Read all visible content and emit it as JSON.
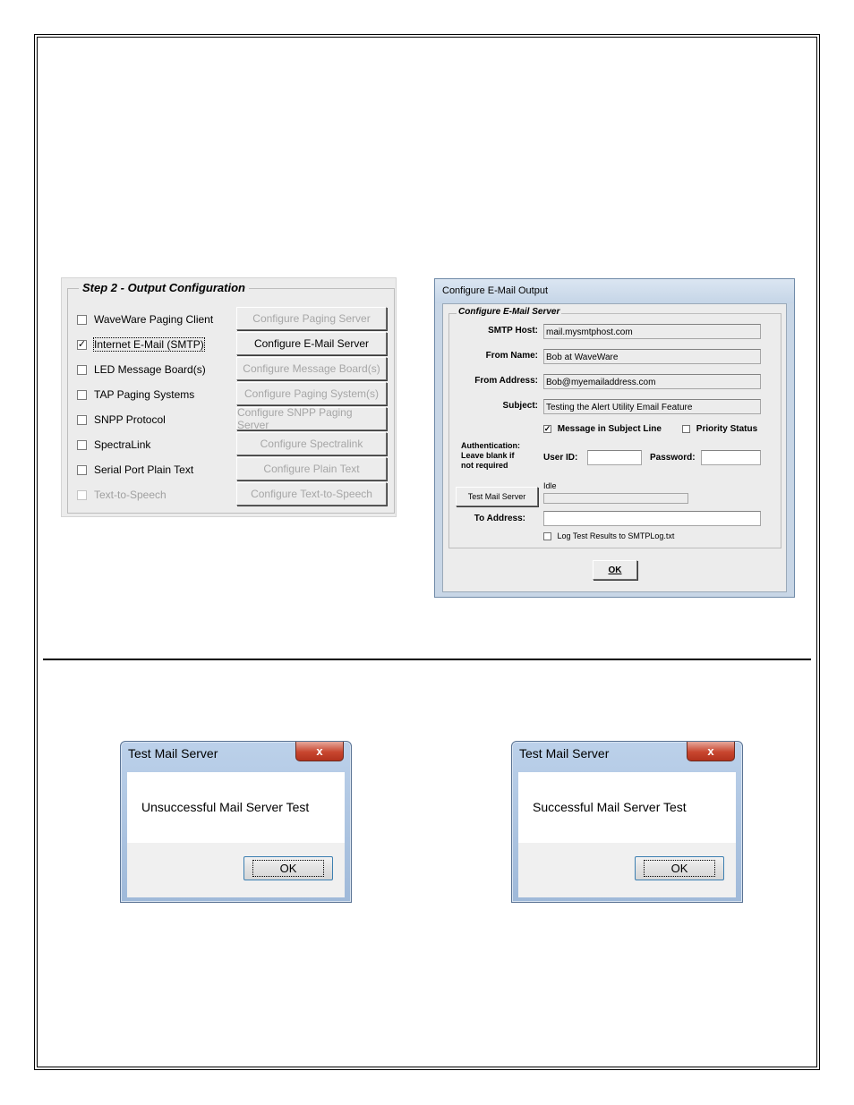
{
  "step2": {
    "title": "Step 2 - Output Configuration",
    "options": [
      {
        "label": "WaveWare Paging Client",
        "checked": false,
        "disabled": false,
        "button": "Configure Paging Server",
        "button_enabled": false
      },
      {
        "label": "Internet E-Mail (SMTP)",
        "checked": true,
        "disabled": false,
        "button": "Configure E-Mail Server",
        "button_enabled": true
      },
      {
        "label": "LED Message Board(s)",
        "checked": false,
        "disabled": false,
        "button": "Configure Message Board(s)",
        "button_enabled": false
      },
      {
        "label": "TAP Paging Systems",
        "checked": false,
        "disabled": false,
        "button": "Configure Paging System(s)",
        "button_enabled": false
      },
      {
        "label": "SNPP Protocol",
        "checked": false,
        "disabled": false,
        "button": "Configure SNPP Paging Server",
        "button_enabled": false
      },
      {
        "label": "SpectraLink",
        "checked": false,
        "disabled": false,
        "button": "Configure Spectralink",
        "button_enabled": false
      },
      {
        "label": "Serial Port Plain Text",
        "checked": false,
        "disabled": false,
        "button": "Configure Plain Text",
        "button_enabled": false
      },
      {
        "label": "Text-to-Speech",
        "checked": false,
        "disabled": true,
        "button": "Configure Text-to-Speech",
        "button_enabled": false
      }
    ]
  },
  "email_dialog": {
    "title": "Configure E-Mail Output",
    "group_title": "Configure E-Mail Server",
    "smtp_host_label": "SMTP Host:",
    "smtp_host_value": "mail.mysmtphost.com",
    "from_name_label": "From Name:",
    "from_name_value": "Bob at WaveWare",
    "from_address_label": "From Address:",
    "from_address_value": "Bob@myemailaddress.com",
    "subject_label": "Subject:",
    "subject_value": "Testing the Alert Utility Email Feature",
    "message_in_subject_label": "Message in Subject Line",
    "message_in_subject_checked": true,
    "priority_status_label": "Priority Status",
    "priority_status_checked": false,
    "auth_label_1": "Authentication:",
    "auth_label_2": "Leave blank if",
    "auth_label_3": "not required",
    "user_id_label": "User ID:",
    "user_id_value": "",
    "password_label": "Password:",
    "password_value": "",
    "test_button": "Test Mail Server",
    "status_text": "Idle",
    "to_address_label": "To Address:",
    "to_address_value": "",
    "log_label": "Log Test Results to SMTPLog.txt",
    "log_checked": false,
    "ok_button": "OK"
  },
  "msg_fail": {
    "title": "Test Mail Server",
    "close": "x",
    "message": "Unsuccessful Mail Server Test",
    "ok": "OK"
  },
  "msg_success": {
    "title": "Test Mail Server",
    "close": "x",
    "message": "Successful Mail Server Test",
    "ok": "OK"
  }
}
